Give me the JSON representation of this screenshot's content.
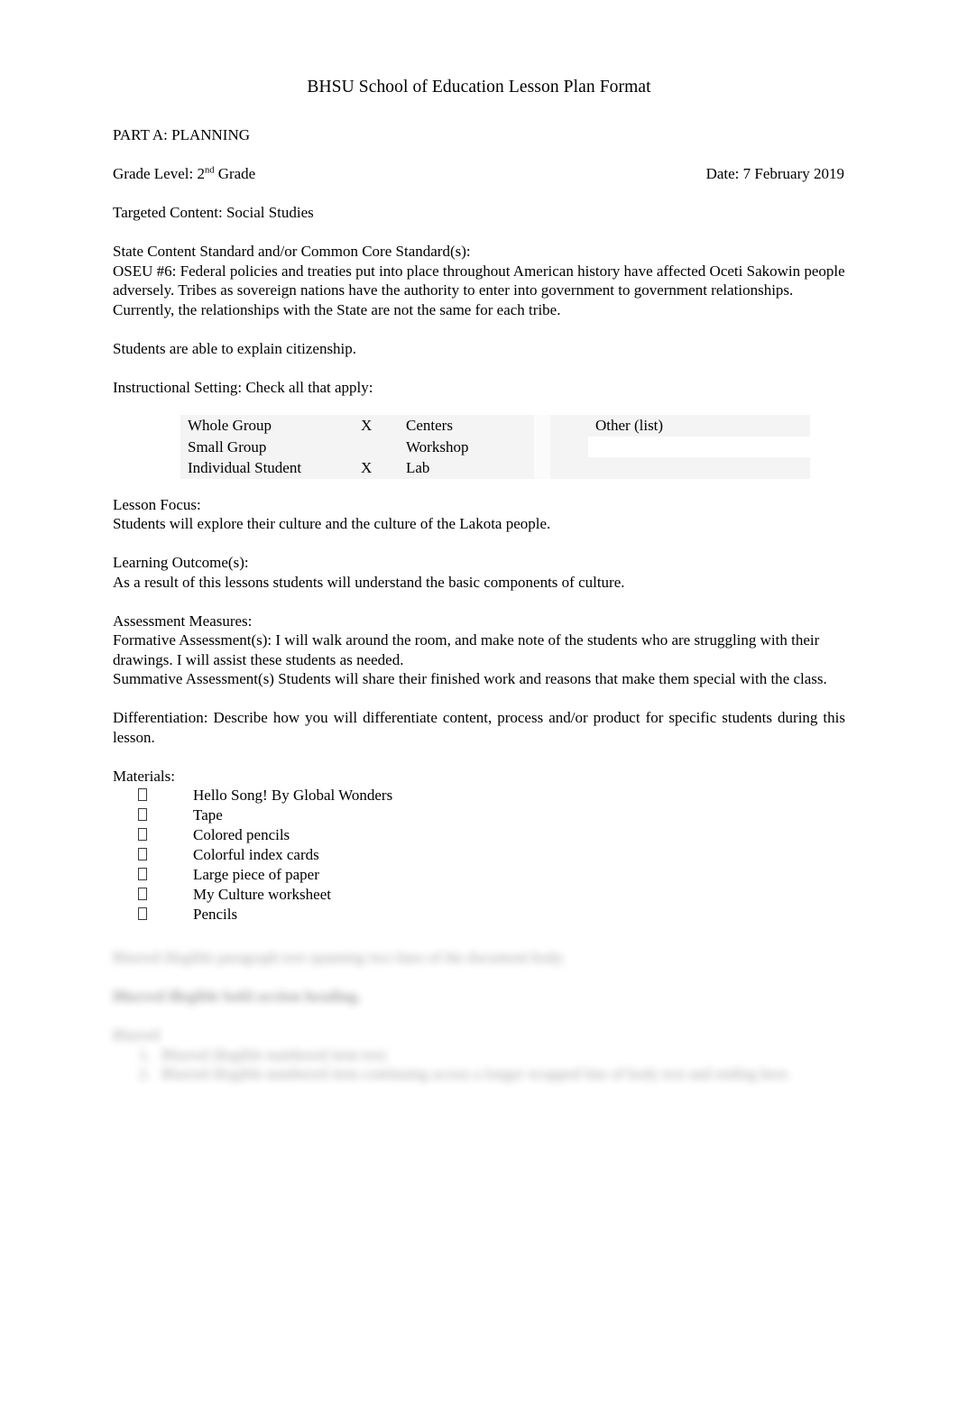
{
  "document": {
    "title": "BHSU School of Education Lesson Plan Format",
    "part_a_heading": "PART A: PLANNING",
    "grade_level": {
      "label": "Grade Level: 2",
      "ordinal": "nd",
      "suffix": " Grade"
    },
    "date": "Date: 7 February 2019",
    "targeted_content": "Targeted Content: Social Studies",
    "standard_heading": "State Content Standard and/or Common Core Standard(s):",
    "standard_body": "OSEU #6: Federal policies and treaties put into place throughout American history have affected Oceti Sakowin people adversely. Tribes as sovereign nations have the authority to enter into government to government relationships. Currently, the relationships with the State are not the same for each tribe.",
    "citizenship_note": "Students are able to explain citizenship.",
    "instructional_setting_heading": "Instructional Setting: Check all that apply:",
    "lesson_focus_heading": "Lesson Focus:",
    "lesson_focus_body": "Students will explore their culture and the culture of the Lakota people.",
    "learning_outcome_heading": "Learning Outcome(s):",
    "learning_outcome_body": "As a result of this lessons students will understand the basic components of culture.",
    "assessment_heading": "Assessment Measures:",
    "formative_assessment": "Formative Assessment(s): I will walk around the room, and make note of the students who are struggling with their drawings. I will assist these students as needed.",
    "summative_assessment": "Summative Assessment(s) Students will share their finished work and reasons that make them special with the class.",
    "differentiation": "Differentiation: Describe how you will differentiate content, process and/or product for specific students during this lesson.",
    "materials_heading": "Materials:"
  },
  "instructional_setting": {
    "rows": [
      {
        "label": "Whole Group",
        "mark": "X",
        "label2": "Centers",
        "mark2": "",
        "other": "Other (list)"
      },
      {
        "label": "Small Group",
        "mark": "",
        "label2": "Workshop",
        "mark2": "",
        "other": ""
      },
      {
        "label": "Individual Student",
        "mark": "X",
        "label2": "Lab",
        "mark2": "",
        "other": ""
      }
    ],
    "other_input_value": ""
  },
  "materials": {
    "bullet_glyph": "missing-glyph-box",
    "items": [
      "Hello Song! By Global Wonders",
      "Tape",
      "Colored pencils",
      "Colorful index cards",
      "Large piece of paper",
      "My Culture worksheet",
      "Pencils"
    ]
  },
  "obscured": {
    "note": "blurred-illegible",
    "paragraph": "Blurred illegible paragraph text spanning two lines of the document body.",
    "heading": "Blurred illegible bold section heading.",
    "label": "Blurred",
    "numbered_items": [
      "Blurred illegible numbered item text.",
      "Blurred illegible numbered item continuing across a longer wrapped line of body text and ending here."
    ]
  },
  "colors": {
    "page_background": "#ffffff",
    "text": "#000000",
    "table_cell_fill": "#f4f4f4",
    "input_fill": "#ffffff"
  }
}
